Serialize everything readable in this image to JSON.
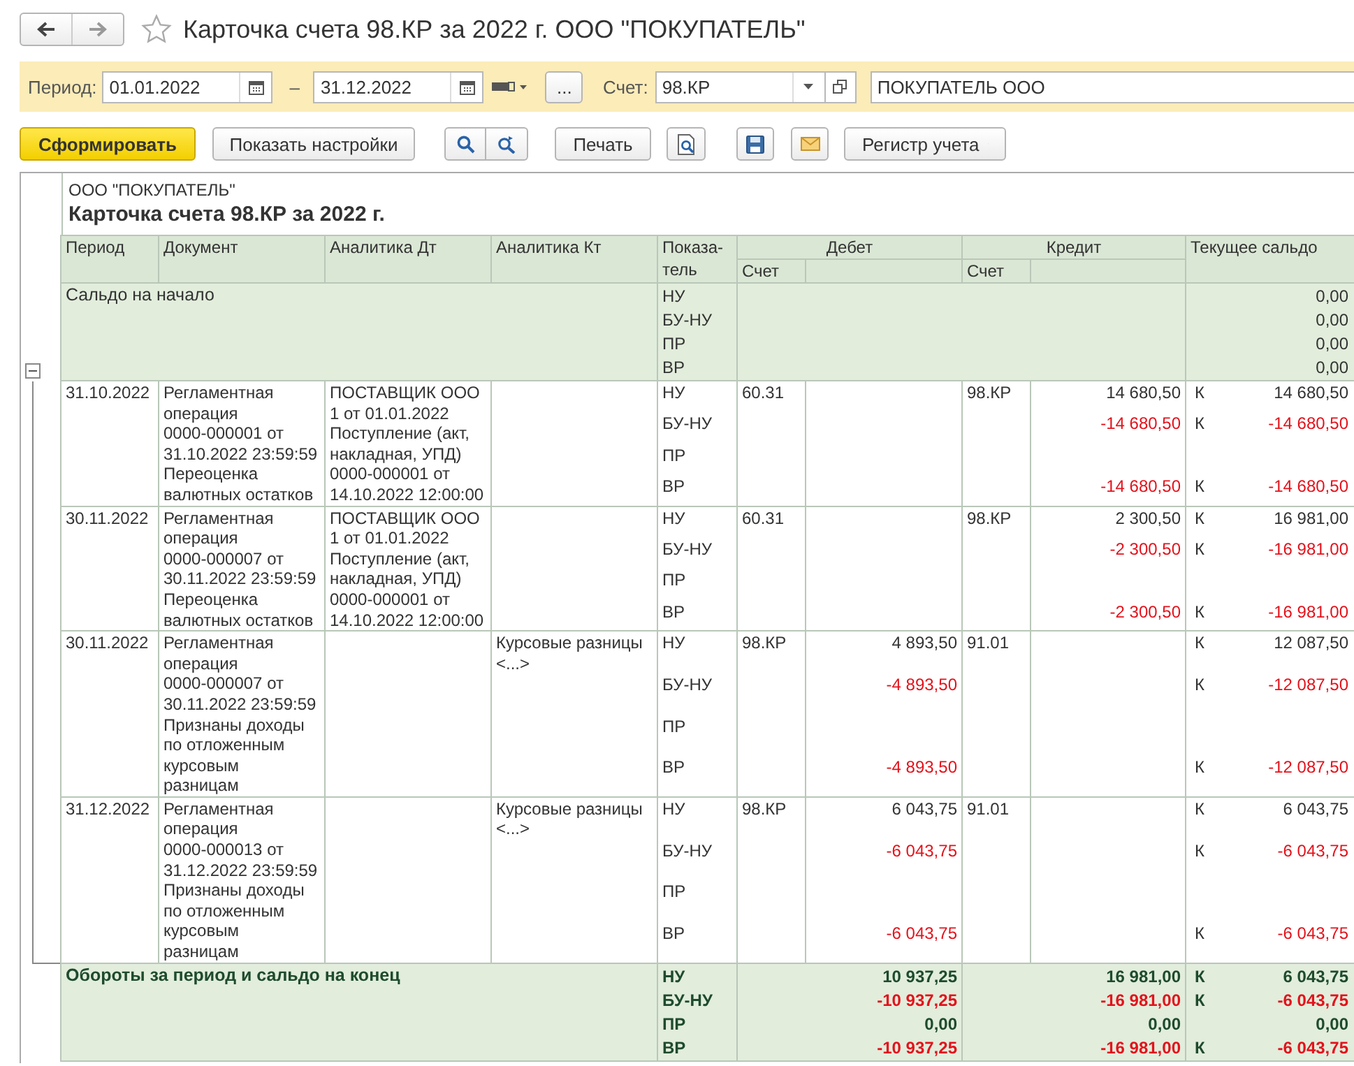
{
  "window": {
    "title": "Карточка счета 98.КР за 2022 г. ООО \"ПОКУПАТЕЛЬ\"",
    "favorite": false
  },
  "filters": {
    "period_label": "Период:",
    "date_from": "01.01.2022",
    "dash": "–",
    "date_to": "31.12.2022",
    "more_button": "...",
    "account_label": "Счет:",
    "account": "98.КР",
    "counterparty": "ПОКУПАТЕЛЬ ООО"
  },
  "toolbar": {
    "generate": "Сформировать",
    "settings": "Показать настройки",
    "print": "Печать",
    "register": "Регистр учета"
  },
  "report": {
    "company": "ООО \"ПОКУПАТЕЛЬ\"",
    "title": "Карточка счета 98.КР за 2022 г.",
    "expanded": true,
    "columns": {
      "period": "Период",
      "document": "Документ",
      "analytics_dt": "Аналитика Дт",
      "analytics_kt": "Аналитика Кт",
      "indicator": "Показа-тель",
      "debit": "Дебет",
      "debit_account": "Счет",
      "credit": "Кредит",
      "credit_account": "Счет",
      "balance": "Текущее сальдо"
    },
    "opening": {
      "label": "Сальдо на начало",
      "lines": [
        {
          "indicator": "НУ",
          "balance": "0,00"
        },
        {
          "indicator": "БУ-НУ",
          "balance": "0,00"
        },
        {
          "indicator": "ПР",
          "balance": "0,00"
        },
        {
          "indicator": "ВР",
          "balance": "0,00"
        }
      ]
    },
    "rows": [
      {
        "period": "31.10.2022",
        "document": "Регламентная\nоперация\n0000-000001 от\n31.10.2022 23:59:59\nПереоценка\nвалютных остатков",
        "analytics_dt": "ПОСТАВЩИК ООО\n1 от 01.01.2022\nПоступление (акт,\nнакладная, УПД)\n0000-000001 от\n14.10.2022 12:00:00",
        "lines": [
          {
            "indicator": "НУ",
            "debit_account": "60.31",
            "credit_account": "98.КР",
            "credit": "14 680,50",
            "side": "К",
            "balance": "14 680,50",
            "negative": false
          },
          {
            "indicator": "БУ-НУ",
            "credit": "-14 680,50",
            "side": "К",
            "balance": "-14 680,50",
            "negative": true
          },
          {
            "indicator": "ПР"
          },
          {
            "indicator": "ВР",
            "credit": "-14 680,50",
            "side": "К",
            "balance": "-14 680,50",
            "negative": true
          }
        ]
      },
      {
        "period": "30.11.2022",
        "document": "Регламентная\nоперация\n0000-000007 от\n30.11.2022 23:59:59\nПереоценка\nвалютных остатков",
        "analytics_dt": "ПОСТАВЩИК ООО\n1 от 01.01.2022\nПоступление (акт,\nнакладная, УПД)\n0000-000001 от\n14.10.2022 12:00:00",
        "lines": [
          {
            "indicator": "НУ",
            "debit_account": "60.31",
            "credit_account": "98.КР",
            "credit": "2 300,50",
            "side": "К",
            "balance": "16 981,00",
            "negative": false
          },
          {
            "indicator": "БУ-НУ",
            "credit": "-2 300,50",
            "side": "К",
            "balance": "-16 981,00",
            "negative": true
          },
          {
            "indicator": "ПР"
          },
          {
            "indicator": "ВР",
            "credit": "-2 300,50",
            "side": "К",
            "balance": "-16 981,00",
            "negative": true
          }
        ]
      },
      {
        "period": "30.11.2022",
        "document": "Регламентная\nоперация\n0000-000007 от\n30.11.2022 23:59:59\nПризнаны доходы\nпо отложенным\nкурсовым\nразницам",
        "analytics_kt": "Курсовые разницы\n<...>",
        "lines": [
          {
            "indicator": "НУ",
            "debit_account": "98.КР",
            "debit": "4 893,50",
            "credit_account": "91.01",
            "side": "К",
            "balance": "12 087,50",
            "negative": false
          },
          {
            "indicator": "БУ-НУ",
            "debit": "-4 893,50",
            "side": "К",
            "balance": "-12 087,50",
            "negative": true
          },
          {
            "indicator": "ПР"
          },
          {
            "indicator": "ВР",
            "debit": "-4 893,50",
            "side": "К",
            "balance": "-12 087,50",
            "negative": true
          }
        ]
      },
      {
        "period": "31.12.2022",
        "document": "Регламентная\nоперация\n0000-000013 от\n31.12.2022 23:59:59\nПризнаны доходы\nпо отложенным\nкурсовым\nразницам",
        "analytics_kt": "Курсовые разницы\n<...>",
        "lines": [
          {
            "indicator": "НУ",
            "debit_account": "98.КР",
            "debit": "6 043,75",
            "credit_account": "91.01",
            "side": "К",
            "balance": "6 043,75",
            "negative": false
          },
          {
            "indicator": "БУ-НУ",
            "debit": "-6 043,75",
            "side": "К",
            "balance": "-6 043,75",
            "negative": true
          },
          {
            "indicator": "ПР"
          },
          {
            "indicator": "ВР",
            "debit": "-6 043,75",
            "side": "К",
            "balance": "-6 043,75",
            "negative": true
          }
        ]
      }
    ],
    "totals": {
      "label": "Обороты за период и сальдо на конец",
      "lines": [
        {
          "indicator": "НУ",
          "debit": "10 937,25",
          "credit": "16 981,00",
          "side": "К",
          "balance": "6 043,75",
          "negative": false
        },
        {
          "indicator": "БУ-НУ",
          "debit": "-10 937,25",
          "credit": "-16 981,00",
          "side": "К",
          "balance": "-6 043,75",
          "negative": true
        },
        {
          "indicator": "ПР",
          "debit": "0,00",
          "credit": "0,00",
          "balance": "0,00",
          "negative": false
        },
        {
          "indicator": "ВР",
          "debit": "-10 937,25",
          "credit": "-16 981,00",
          "side": "К",
          "balance": "-6 043,75",
          "negative": true
        }
      ]
    }
  }
}
